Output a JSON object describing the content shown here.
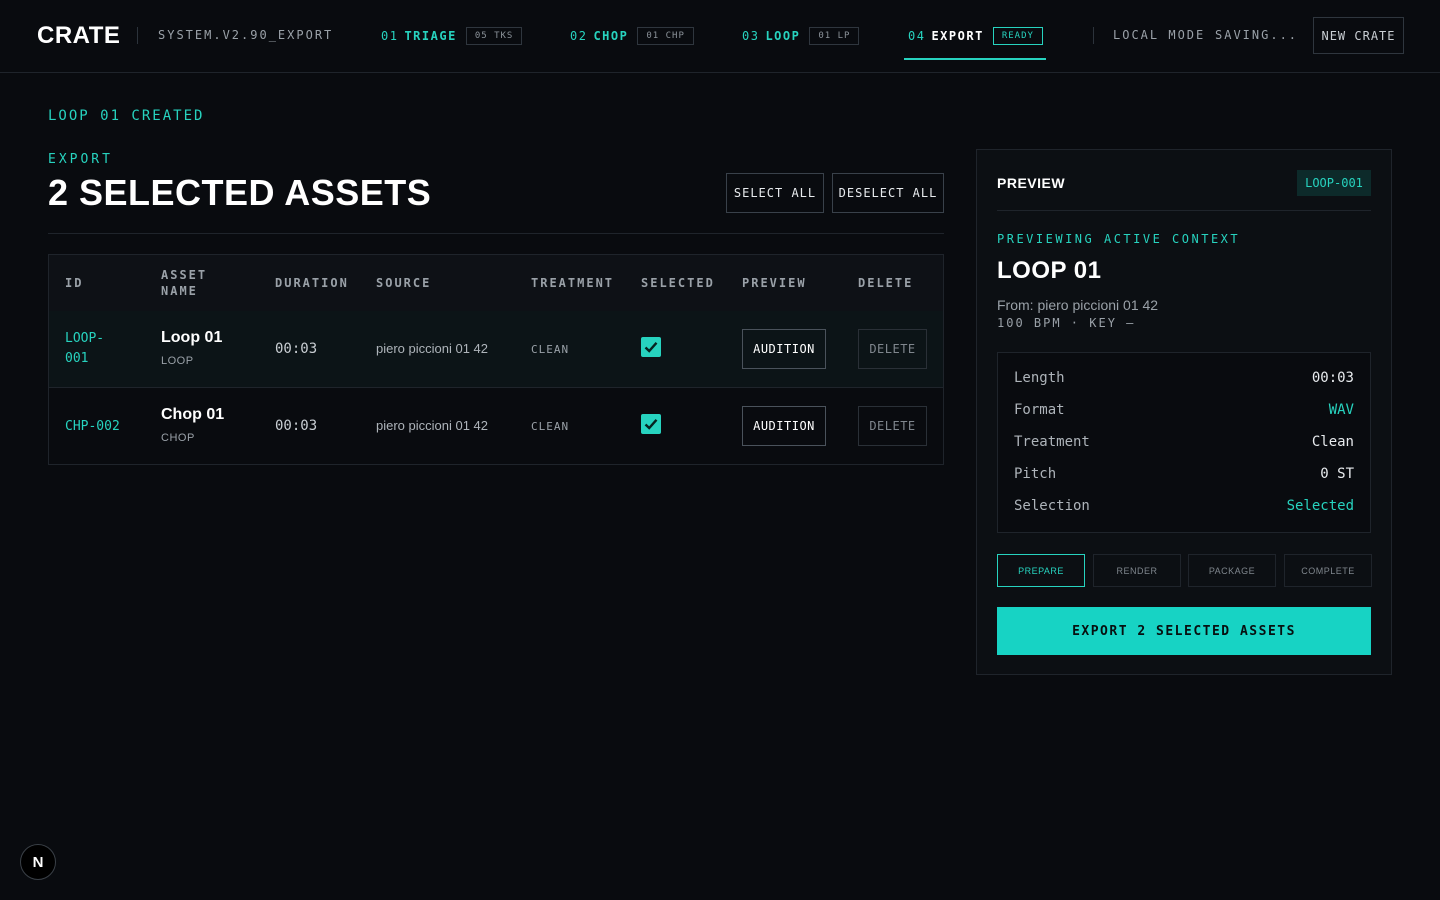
{
  "header": {
    "logo": "CRATE",
    "system": "SYSTEM.V2.90_EXPORT",
    "steps": [
      {
        "num": "01",
        "name": "TRIAGE",
        "tag": "05 TKS"
      },
      {
        "num": "02",
        "name": "CHOP",
        "tag": "01 CHP"
      },
      {
        "num": "03",
        "name": "LOOP",
        "tag": "01 LP"
      },
      {
        "num": "04",
        "name": "EXPORT",
        "tag": "READY"
      }
    ],
    "mode": "LOCAL MODE",
    "saving": "SAVING...",
    "new_crate": "NEW CRATE"
  },
  "main": {
    "notice": "LOOP 01 CREATED",
    "eyebrow": "EXPORT",
    "title": "2 SELECTED ASSETS",
    "select_all": "SELECT ALL",
    "deselect_all": "DESELECT ALL",
    "columns": {
      "id": "ID",
      "asset_name_1": "ASSET",
      "asset_name_2": "NAME",
      "duration": "DURATION",
      "source": "SOURCE",
      "treatment": "TREATMENT",
      "selected": "SELECTED",
      "preview": "PREVIEW",
      "delete": "DELETE"
    },
    "rows": [
      {
        "id_1": "LOOP-",
        "id_2": "001",
        "name": "Loop 01",
        "type": "LOOP",
        "duration": "00:03",
        "source": "piero piccioni 01 42",
        "treatment": "CLEAN",
        "selected": true,
        "preview": "AUDITION",
        "delete": "DELETE"
      },
      {
        "id": "CHP-002",
        "name": "Chop 01",
        "type": "CHOP",
        "duration": "00:03",
        "source": "piero piccioni 01 42",
        "treatment": "CLEAN",
        "selected": true,
        "preview": "AUDITION",
        "delete": "DELETE"
      }
    ]
  },
  "preview": {
    "title": "PREVIEW",
    "badge": "LOOP-001",
    "eyebrow": "PREVIEWING ACTIVE CONTEXT",
    "name": "LOOP 01",
    "from": "From: piero piccioni 01 42",
    "meta": "100 BPM · KEY —",
    "props": [
      {
        "key": "Length",
        "value": "00:03"
      },
      {
        "key": "Format",
        "value": "WAV"
      },
      {
        "key": "Treatment",
        "value": "Clean"
      },
      {
        "key": "Pitch",
        "value": "0 ST"
      },
      {
        "key": "Selection",
        "value": "Selected"
      }
    ],
    "stages": [
      "PREPARE",
      "RENDER",
      "PACKAGE",
      "COMPLETE"
    ],
    "active_stage": "PREPARE",
    "export_button": "EXPORT 2 SELECTED ASSETS"
  },
  "fab": "N",
  "colors": {
    "accent": "#27d3bf",
    "background": "#090b0f",
    "export_button": "#17d3c4"
  }
}
